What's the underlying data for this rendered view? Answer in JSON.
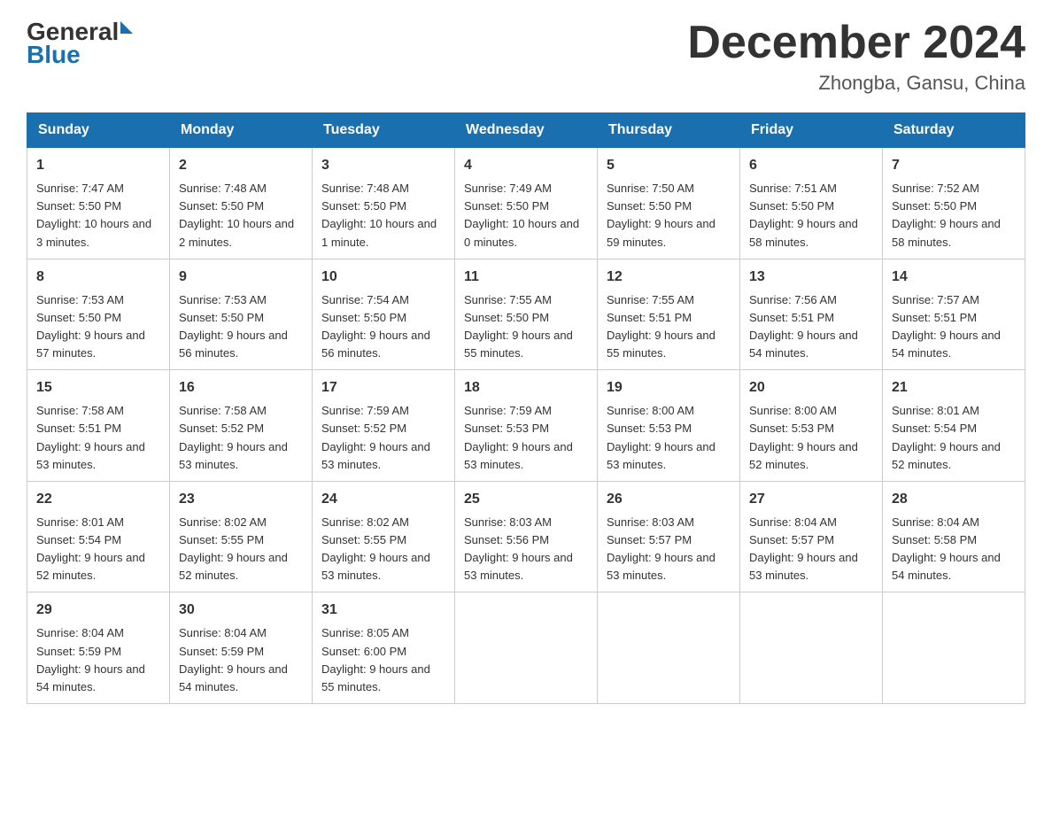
{
  "header": {
    "logo_general": "General",
    "logo_triangle": "",
    "logo_blue": "Blue",
    "month_title": "December 2024",
    "location": "Zhongba, Gansu, China"
  },
  "columns": [
    "Sunday",
    "Monday",
    "Tuesday",
    "Wednesday",
    "Thursday",
    "Friday",
    "Saturday"
  ],
  "rows": [
    [
      {
        "day": "1",
        "sunrise": "7:47 AM",
        "sunset": "5:50 PM",
        "daylight": "10 hours and 3 minutes."
      },
      {
        "day": "2",
        "sunrise": "7:48 AM",
        "sunset": "5:50 PM",
        "daylight": "10 hours and 2 minutes."
      },
      {
        "day": "3",
        "sunrise": "7:48 AM",
        "sunset": "5:50 PM",
        "daylight": "10 hours and 1 minute."
      },
      {
        "day": "4",
        "sunrise": "7:49 AM",
        "sunset": "5:50 PM",
        "daylight": "10 hours and 0 minutes."
      },
      {
        "day": "5",
        "sunrise": "7:50 AM",
        "sunset": "5:50 PM",
        "daylight": "9 hours and 59 minutes."
      },
      {
        "day": "6",
        "sunrise": "7:51 AM",
        "sunset": "5:50 PM",
        "daylight": "9 hours and 58 minutes."
      },
      {
        "day": "7",
        "sunrise": "7:52 AM",
        "sunset": "5:50 PM",
        "daylight": "9 hours and 58 minutes."
      }
    ],
    [
      {
        "day": "8",
        "sunrise": "7:53 AM",
        "sunset": "5:50 PM",
        "daylight": "9 hours and 57 minutes."
      },
      {
        "day": "9",
        "sunrise": "7:53 AM",
        "sunset": "5:50 PM",
        "daylight": "9 hours and 56 minutes."
      },
      {
        "day": "10",
        "sunrise": "7:54 AM",
        "sunset": "5:50 PM",
        "daylight": "9 hours and 56 minutes."
      },
      {
        "day": "11",
        "sunrise": "7:55 AM",
        "sunset": "5:50 PM",
        "daylight": "9 hours and 55 minutes."
      },
      {
        "day": "12",
        "sunrise": "7:55 AM",
        "sunset": "5:51 PM",
        "daylight": "9 hours and 55 minutes."
      },
      {
        "day": "13",
        "sunrise": "7:56 AM",
        "sunset": "5:51 PM",
        "daylight": "9 hours and 54 minutes."
      },
      {
        "day": "14",
        "sunrise": "7:57 AM",
        "sunset": "5:51 PM",
        "daylight": "9 hours and 54 minutes."
      }
    ],
    [
      {
        "day": "15",
        "sunrise": "7:58 AM",
        "sunset": "5:51 PM",
        "daylight": "9 hours and 53 minutes."
      },
      {
        "day": "16",
        "sunrise": "7:58 AM",
        "sunset": "5:52 PM",
        "daylight": "9 hours and 53 minutes."
      },
      {
        "day": "17",
        "sunrise": "7:59 AM",
        "sunset": "5:52 PM",
        "daylight": "9 hours and 53 minutes."
      },
      {
        "day": "18",
        "sunrise": "7:59 AM",
        "sunset": "5:53 PM",
        "daylight": "9 hours and 53 minutes."
      },
      {
        "day": "19",
        "sunrise": "8:00 AM",
        "sunset": "5:53 PM",
        "daylight": "9 hours and 53 minutes."
      },
      {
        "day": "20",
        "sunrise": "8:00 AM",
        "sunset": "5:53 PM",
        "daylight": "9 hours and 52 minutes."
      },
      {
        "day": "21",
        "sunrise": "8:01 AM",
        "sunset": "5:54 PM",
        "daylight": "9 hours and 52 minutes."
      }
    ],
    [
      {
        "day": "22",
        "sunrise": "8:01 AM",
        "sunset": "5:54 PM",
        "daylight": "9 hours and 52 minutes."
      },
      {
        "day": "23",
        "sunrise": "8:02 AM",
        "sunset": "5:55 PM",
        "daylight": "9 hours and 52 minutes."
      },
      {
        "day": "24",
        "sunrise": "8:02 AM",
        "sunset": "5:55 PM",
        "daylight": "9 hours and 53 minutes."
      },
      {
        "day": "25",
        "sunrise": "8:03 AM",
        "sunset": "5:56 PM",
        "daylight": "9 hours and 53 minutes."
      },
      {
        "day": "26",
        "sunrise": "8:03 AM",
        "sunset": "5:57 PM",
        "daylight": "9 hours and 53 minutes."
      },
      {
        "day": "27",
        "sunrise": "8:04 AM",
        "sunset": "5:57 PM",
        "daylight": "9 hours and 53 minutes."
      },
      {
        "day": "28",
        "sunrise": "8:04 AM",
        "sunset": "5:58 PM",
        "daylight": "9 hours and 54 minutes."
      }
    ],
    [
      {
        "day": "29",
        "sunrise": "8:04 AM",
        "sunset": "5:59 PM",
        "daylight": "9 hours and 54 minutes."
      },
      {
        "day": "30",
        "sunrise": "8:04 AM",
        "sunset": "5:59 PM",
        "daylight": "9 hours and 54 minutes."
      },
      {
        "day": "31",
        "sunrise": "8:05 AM",
        "sunset": "6:00 PM",
        "daylight": "9 hours and 55 minutes."
      },
      null,
      null,
      null,
      null
    ]
  ],
  "labels": {
    "sunrise": "Sunrise:",
    "sunset": "Sunset:",
    "daylight": "Daylight:"
  }
}
